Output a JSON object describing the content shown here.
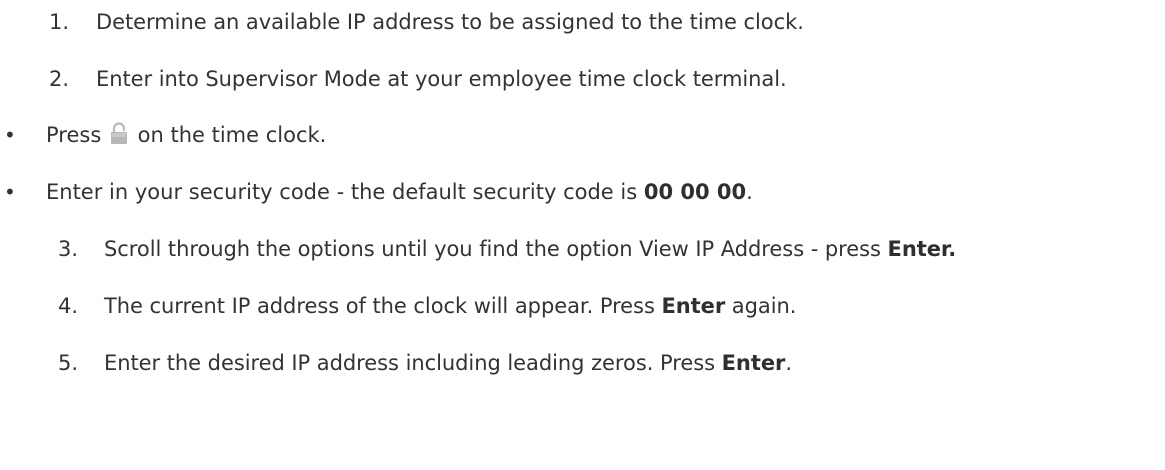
{
  "steps": [
    {
      "number": "1.",
      "text": "Determine an available IP address to be assigned to the time clock."
    },
    {
      "number": "2.",
      "text": "Enter into Supervisor Mode at your employee time clock terminal."
    },
    {
      "number": "3.",
      "text_before": "Scroll through the options until you find the option View IP Address - press ",
      "bold": "Enter."
    },
    {
      "number": "4.",
      "text_before": "The current IP address of the clock will appear. Press ",
      "bold": "Enter",
      "text_after": " again."
    },
    {
      "number": "5.",
      "text_before": "Enter the desired IP address including leading zeros. Press ",
      "bold": "Enter",
      "text_after": "."
    }
  ],
  "bullets": [
    {
      "symbol": "•",
      "text_before": "Press ",
      "icon": "lock-icon",
      "text_after": " on the time clock."
    },
    {
      "symbol": "•",
      "text_before": "Enter in your security code - the default security code is ",
      "bold": "00 00 00",
      "text_after": "."
    }
  ],
  "colors": {
    "text": "#333333",
    "icon": "#b8b8b8"
  }
}
